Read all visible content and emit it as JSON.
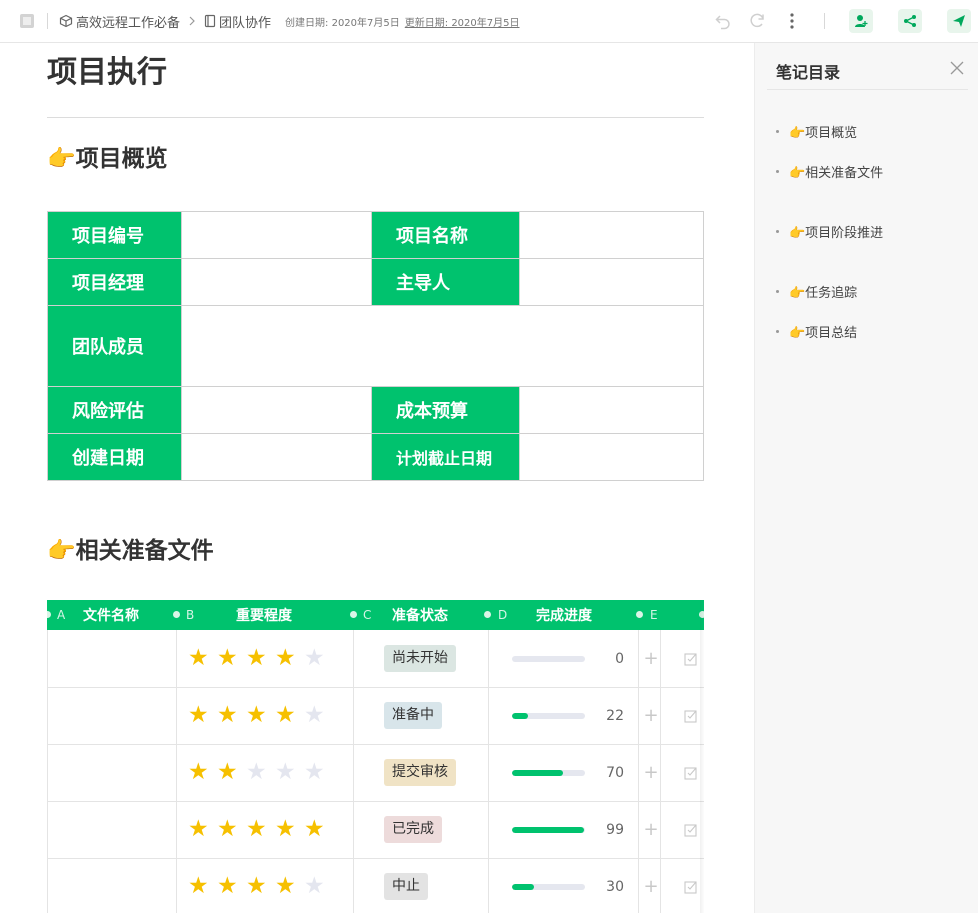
{
  "topbar": {
    "breadcrumb": [
      {
        "icon": "cube-icon",
        "label": "高效远程工作必备"
      },
      {
        "icon": "document-icon",
        "label": "团队协作"
      }
    ],
    "created": "创建日期: 2020年7月5日",
    "updated": "更新日期: 2020年7月5日"
  },
  "doc": {
    "title": "项目执行",
    "section1": "👉项目概览",
    "section2": "👉相关准备文件"
  },
  "overview": {
    "project_no": "项目编号",
    "project_name": "项目名称",
    "manager": "项目经理",
    "leader": "主导人",
    "members": "团队成员",
    "risk": "风险评估",
    "budget": "成本预算",
    "created_date": "创建日期",
    "deadline": "计划截止日期"
  },
  "grid": {
    "columns": [
      {
        "letter": "A",
        "label": "文件名称"
      },
      {
        "letter": "B",
        "label": "重要程度"
      },
      {
        "letter": "C",
        "label": "准备状态"
      },
      {
        "letter": "D",
        "label": "完成进度"
      },
      {
        "letter": "E",
        "label": ""
      }
    ],
    "rows": [
      {
        "stars": 4,
        "status": "尚未开始",
        "status_bg": "#dbe6e2",
        "progress": "0",
        "fill": 0
      },
      {
        "stars": 4,
        "status": "准备中",
        "status_bg": "#d8e5ea",
        "progress": "22",
        "fill": 0.22
      },
      {
        "stars": 2,
        "status": "提交审核",
        "status_bg": "#f0e3c5",
        "progress": "70",
        "fill": 0.7
      },
      {
        "stars": 5,
        "status": "已完成",
        "status_bg": "#eddbdb",
        "progress": "99",
        "fill": 0.99
      },
      {
        "stars": 4,
        "status": "中止",
        "status_bg": "#e3e3e3",
        "progress": "30",
        "fill": 0.3
      }
    ]
  },
  "sidebar": {
    "title": "笔记目录",
    "items": [
      "👉项目概览",
      "👉相关准备文件",
      "👉项目阶段推进",
      "👉任务追踪",
      "👉项目总结"
    ]
  },
  "colors": {
    "accent": "#00c26e",
    "star": "#f6c000",
    "star_off": "#e4e6ef"
  }
}
